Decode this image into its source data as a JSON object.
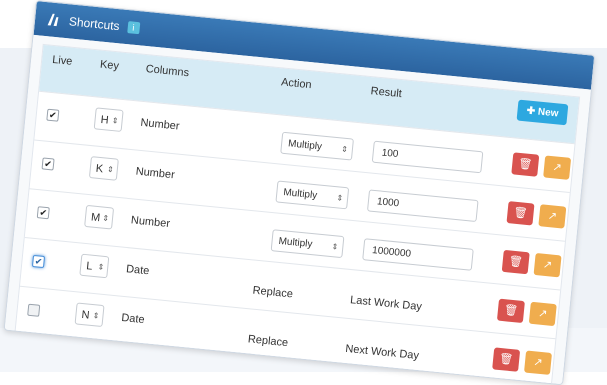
{
  "panel": {
    "title": "Shortcuts",
    "badge_icon": "info-icon",
    "new_button_label": "New"
  },
  "columns": [
    "Live",
    "Key",
    "Columns",
    "Action",
    "Result"
  ],
  "rows": [
    {
      "live": true,
      "key": "H",
      "column": "Number",
      "action_type": "select",
      "action": "Multiply",
      "result_type": "input",
      "result": "100"
    },
    {
      "live": true,
      "key": "K",
      "column": "Number",
      "action_type": "select",
      "action": "Multiply",
      "result_type": "input",
      "result": "1000"
    },
    {
      "live": true,
      "key": "M",
      "column": "Number",
      "action_type": "select",
      "action": "Multiply",
      "result_type": "input",
      "result": "1000000"
    },
    {
      "live": true,
      "key": "L",
      "column": "Date",
      "action_type": "text",
      "action": "Replace",
      "result_type": "text",
      "result": "Last Work Day"
    },
    {
      "live": false,
      "key": "N",
      "column": "Date",
      "action_type": "text",
      "action": "Replace",
      "result_type": "text",
      "result": "Next Work Day"
    }
  ],
  "colors": {
    "header": "#2c64a0",
    "new_button": "#2da8e0",
    "delete_button": "#d9534f",
    "edit_button": "#f0ad4e",
    "table_head": "#d6ebf5"
  }
}
